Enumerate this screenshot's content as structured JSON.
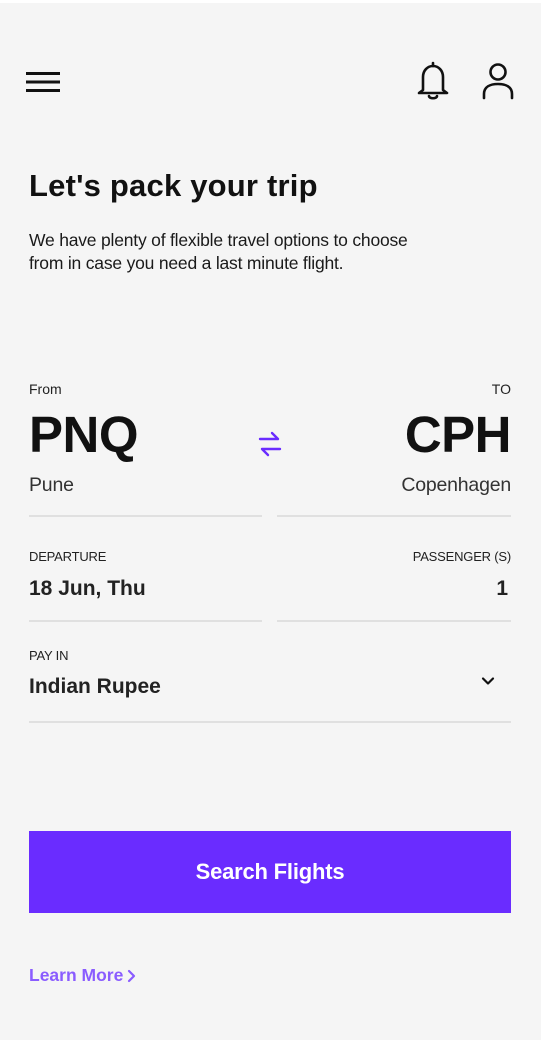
{
  "header": {
    "menu_icon": "hamburger-menu-icon",
    "notification_icon": "bell-icon",
    "profile_icon": "user-icon"
  },
  "intro": {
    "title": "Let's pack your trip",
    "subtitle": "We have plenty of flexible travel options to choose from in case you need a last minute flight."
  },
  "route": {
    "from_label": "From",
    "from_code": "PNQ",
    "from_city": "Pune",
    "to_label": "TO",
    "to_code": "CPH",
    "to_city": "Copenhagen",
    "swap_icon": "swap-arrows-icon"
  },
  "departure": {
    "label": "DEPARTURE",
    "value": "18 Jun, Thu"
  },
  "passengers": {
    "label": "PASSENGER (S)",
    "value": "1"
  },
  "currency": {
    "label": "PAY IN",
    "value": "Indian Rupee",
    "dropdown_icon": "chevron-down-icon"
  },
  "actions": {
    "search_label": "Search Flights",
    "learn_more_label": "Learn More",
    "learn_more_icon": "chevron-right-icon"
  },
  "colors": {
    "accent": "#6a2cff",
    "link": "#8a5cff",
    "background": "#f5f5f5"
  }
}
